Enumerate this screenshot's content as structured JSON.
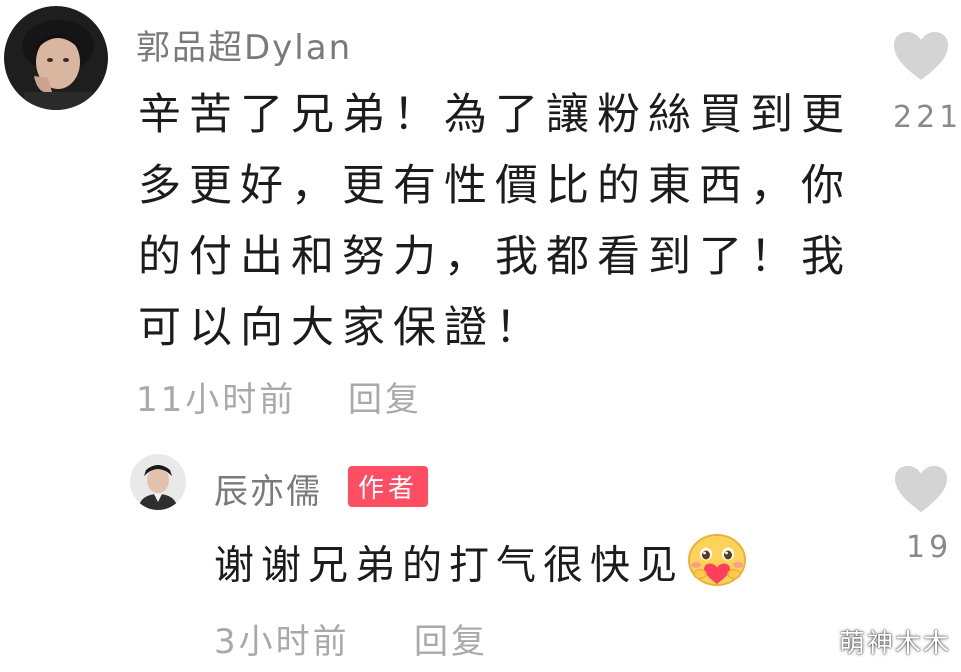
{
  "comment": {
    "username": "郭品超Dylan",
    "text_lines": [
      "辛苦了兄弟！為了讓粉絲買到更",
      "多更好，更有性價比的東西，你",
      "的付出和努力，我都看到了！我",
      "可以向大家保證！"
    ],
    "time": "11小时前",
    "reply_label": "回复",
    "likes": "221",
    "like_icon": "heart-icon"
  },
  "reply": {
    "username": "辰亦儒",
    "badge": "作者",
    "text": "谢谢兄弟的打气很快见",
    "emoji": "blushing-heart-emoji",
    "time": "3小时前",
    "reply_label": "回复",
    "likes": "19",
    "like_icon": "heart-icon"
  },
  "watermark": "萌神木木",
  "colors": {
    "badge": "#ff4d63",
    "heart": "#d4d4d4",
    "username": "#7a7a7a",
    "meta": "#a9a9a9",
    "text": "#1c1c1c"
  }
}
